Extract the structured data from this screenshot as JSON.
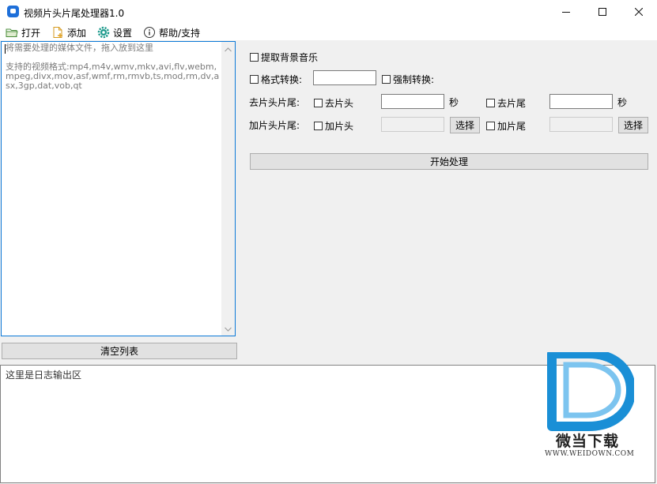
{
  "window": {
    "title": "视频片头片尾处理器1.0"
  },
  "menu": [
    {
      "label": "打开",
      "icon": "folder-icon"
    },
    {
      "label": "添加",
      "icon": "add-file-icon"
    },
    {
      "label": "设置",
      "icon": "gear-icon"
    },
    {
      "label": "帮助/支持",
      "icon": "info-icon"
    }
  ],
  "file_list": {
    "placeholder_line1": "将需要处理的媒体文件，拖入放到这里",
    "placeholder_line2": "支持的视频格式:mp4,m4v,wmv,mkv,avi,flv,webm,mpeg,divx,mov,asf,wmf,rm,rmvb,ts,mod,rm,dv,asx,3gp,dat,vob,qt",
    "clear_button": "清空列表"
  },
  "options": {
    "extract_bg_music": {
      "label": "提取背景音乐",
      "checked": false
    },
    "format_convert": {
      "label": "格式转换:",
      "checked": false,
      "value": ""
    },
    "force_convert": {
      "label": "强制转换:",
      "checked": false
    },
    "remove_row_label": "去片头片尾:",
    "remove_head": {
      "label": "去片头",
      "checked": false,
      "value": "",
      "unit": "秒"
    },
    "remove_tail": {
      "label": "去片尾",
      "checked": false,
      "value": "",
      "unit": "秒"
    },
    "add_row_label": "加片头片尾:",
    "add_head": {
      "label": "加片头",
      "checked": false,
      "value": "",
      "button": "选择"
    },
    "add_tail": {
      "label": "加片尾",
      "checked": false,
      "value": "",
      "button": "选择"
    },
    "start_button": "开始处理"
  },
  "log": {
    "placeholder": "这里是日志输出区"
  },
  "watermark": {
    "brand": "微当下载",
    "url": "WWW.WEIDOWN.COM",
    "color": "#1a8fd6"
  }
}
